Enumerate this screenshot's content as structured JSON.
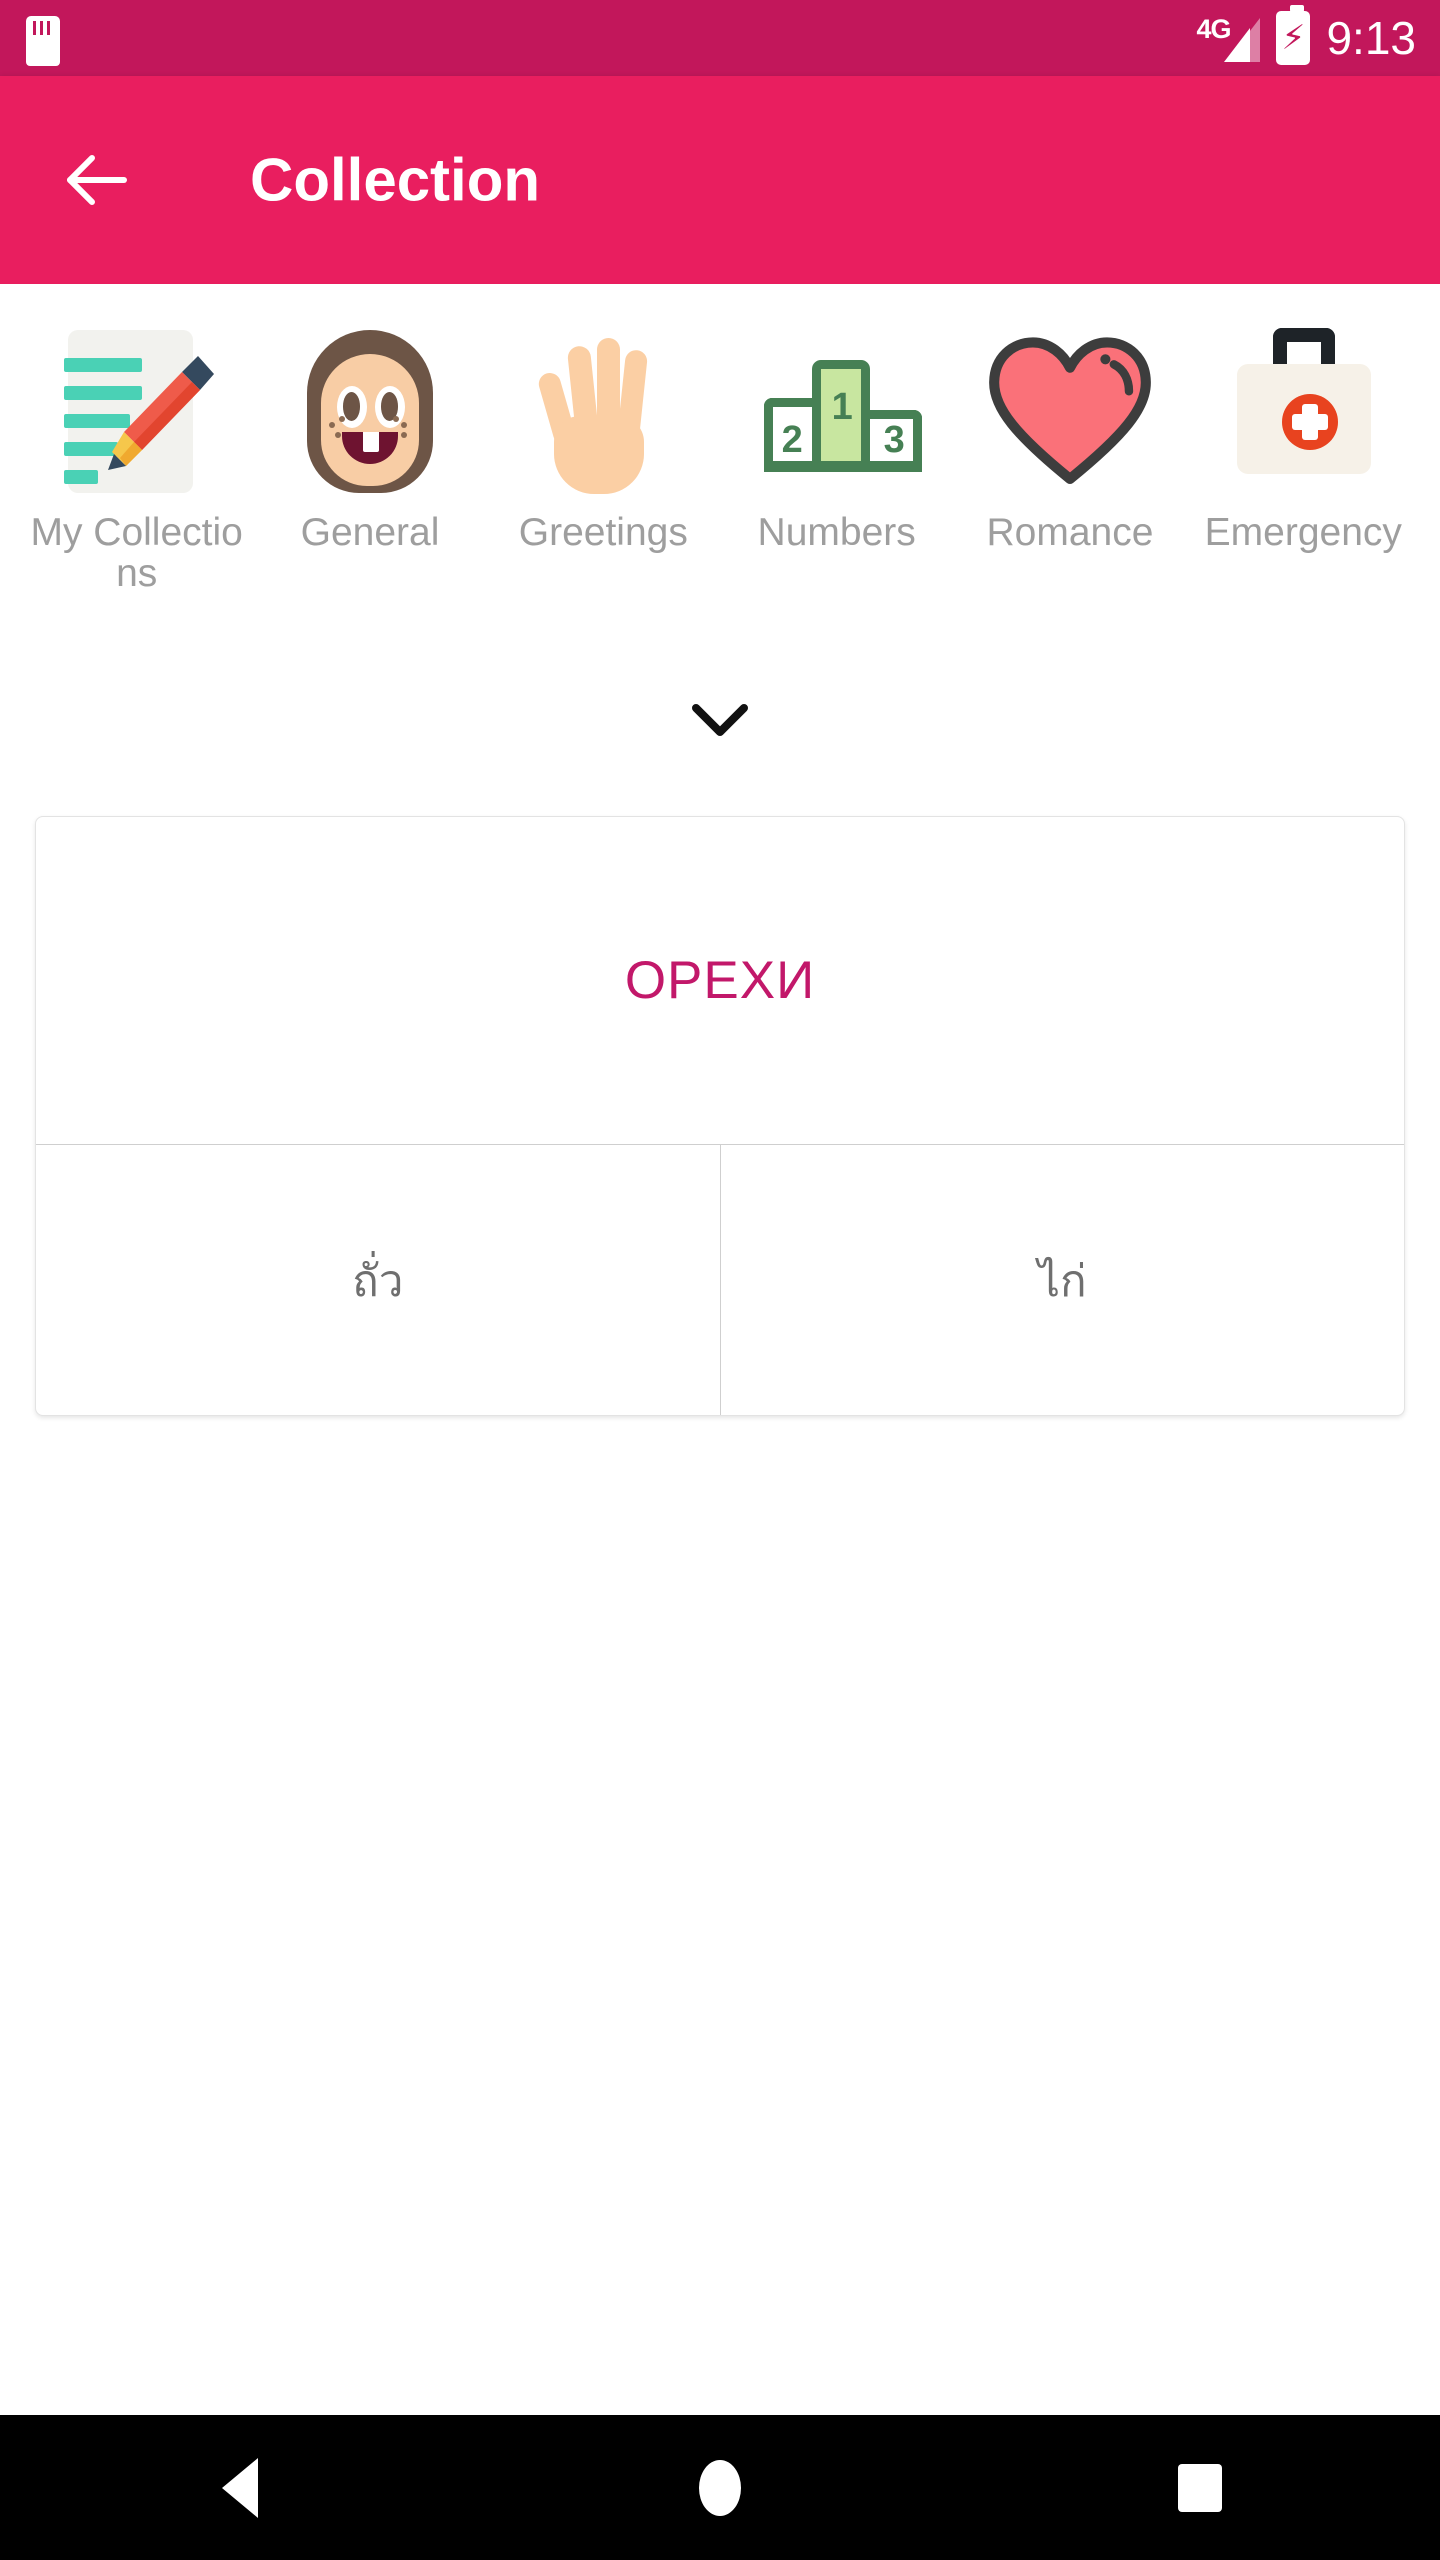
{
  "statusbar": {
    "sd_icon": "sd-card-icon",
    "network_label": "4G",
    "signal_icon": "signal-bars-icon",
    "battery_icon": "battery-charging-icon",
    "time": "9:13"
  },
  "appbar": {
    "back_icon": "back-arrow-icon",
    "title": "Collection",
    "bg_color": "#e91e5f"
  },
  "categories": {
    "expand_icon": "chevron-down-icon",
    "items": [
      {
        "label": "My Collections",
        "icon": "notes-pencil-icon"
      },
      {
        "label": "General",
        "icon": "face-icon"
      },
      {
        "label": "Greetings",
        "icon": "raised-hand-icon"
      },
      {
        "label": "Numbers",
        "icon": "podium-icon"
      },
      {
        "label": "Romance",
        "icon": "heart-icon"
      },
      {
        "label": "Emergency",
        "icon": "first-aid-kit-icon"
      }
    ]
  },
  "card": {
    "word": "ОРЕХИ",
    "word_color": "#c2186a",
    "options": [
      {
        "text": "ถั่ว"
      },
      {
        "text": "ไก่"
      }
    ]
  },
  "navbar": {
    "back_icon": "nav-back-triangle-icon",
    "home_icon": "nav-home-circle-icon",
    "recents_icon": "nav-recents-square-icon"
  },
  "podium": {
    "second": "2",
    "first": "1",
    "third": "3"
  }
}
